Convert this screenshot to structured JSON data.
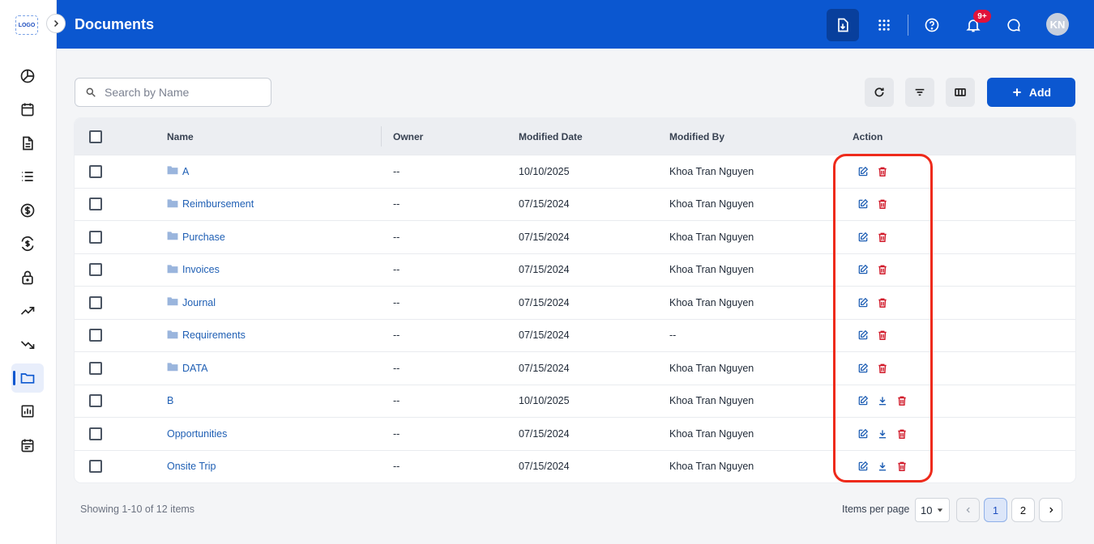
{
  "app": {
    "logo_text": "LOGO"
  },
  "header": {
    "title": "Documents",
    "notification_badge": "9+",
    "avatar_initials": "KN"
  },
  "toolbar": {
    "search_placeholder": "Search by Name",
    "search_value": "",
    "add_label": "Add"
  },
  "sidebar": {
    "items": [
      {
        "icon": "dashboard-pie-icon"
      },
      {
        "icon": "calendar-icon"
      },
      {
        "icon": "document-icon"
      },
      {
        "icon": "list-icon"
      },
      {
        "icon": "dollar-icon"
      },
      {
        "icon": "currency-exchange-icon"
      },
      {
        "icon": "lock-icon"
      },
      {
        "icon": "trending-up-icon"
      },
      {
        "icon": "trending-down-icon"
      },
      {
        "icon": "folder-icon",
        "active": true
      },
      {
        "icon": "report-chart-icon"
      },
      {
        "icon": "event-note-icon"
      }
    ]
  },
  "table": {
    "columns": {
      "name": "Name",
      "owner": "Owner",
      "modified_date": "Modified Date",
      "modified_by": "Modified By",
      "action": "Action"
    },
    "rows": [
      {
        "type": "folder",
        "name": "A",
        "owner": "--",
        "modified_date": "10/10/2025",
        "modified_by": "Khoa Tran Nguyen"
      },
      {
        "type": "folder",
        "name": "Reimbursement",
        "owner": "--",
        "modified_date": "07/15/2024",
        "modified_by": "Khoa Tran Nguyen"
      },
      {
        "type": "folder",
        "name": "Purchase",
        "owner": "--",
        "modified_date": "07/15/2024",
        "modified_by": "Khoa Tran Nguyen"
      },
      {
        "type": "folder",
        "name": "Invoices",
        "owner": "--",
        "modified_date": "07/15/2024",
        "modified_by": "Khoa Tran Nguyen"
      },
      {
        "type": "folder",
        "name": "Journal",
        "owner": "--",
        "modified_date": "07/15/2024",
        "modified_by": "Khoa Tran Nguyen"
      },
      {
        "type": "folder",
        "name": "Requirements",
        "owner": "--",
        "modified_date": "07/15/2024",
        "modified_by": "--"
      },
      {
        "type": "folder",
        "name": "DATA",
        "owner": "--",
        "modified_date": "07/15/2024",
        "modified_by": "Khoa Tran Nguyen"
      },
      {
        "type": "file",
        "name": "B",
        "owner": "--",
        "modified_date": "10/10/2025",
        "modified_by": "Khoa Tran Nguyen"
      },
      {
        "type": "file",
        "name": "Opportunities",
        "owner": "--",
        "modified_date": "07/15/2024",
        "modified_by": "Khoa Tran Nguyen"
      },
      {
        "type": "file",
        "name": "Onsite Trip",
        "owner": "--",
        "modified_date": "07/15/2024",
        "modified_by": "Khoa Tran Nguyen"
      }
    ]
  },
  "footer": {
    "showing_text": "Showing 1-10 of 12 items",
    "items_per_page_label": "Items per page",
    "items_per_page_value": "10",
    "pages": [
      "1",
      "2"
    ],
    "current_page": "1"
  },
  "colors": {
    "brand": "#0b57d0",
    "delete": "#d11a2a",
    "link": "#1f5fb4",
    "highlight": "#ee2a1b"
  }
}
